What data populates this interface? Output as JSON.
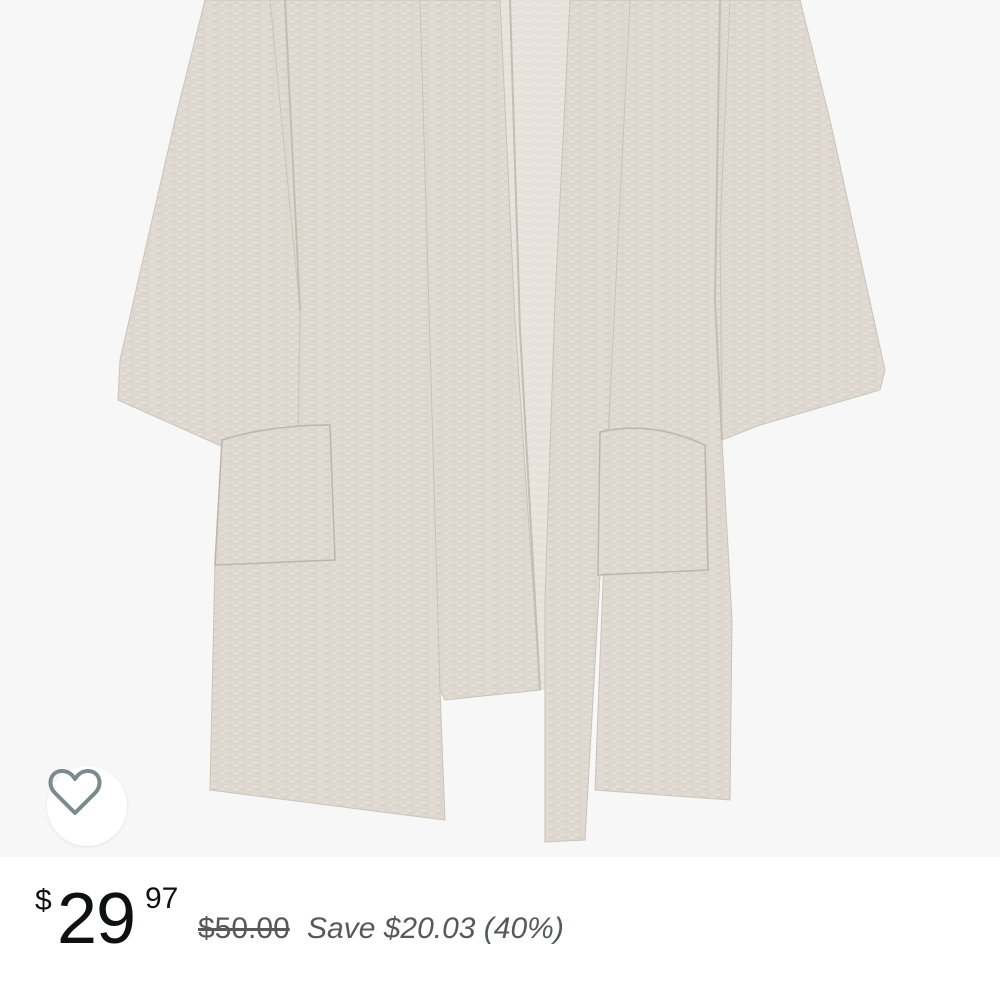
{
  "product": {
    "image_alt": "Oatmeal open-front long cardigan with pockets",
    "favorite_icon": "heart-outline-icon"
  },
  "price": {
    "currency": "$",
    "whole": "29",
    "fraction": "97",
    "list_price": "$50.00",
    "savings": "Save $20.03 (40%)"
  },
  "colors": {
    "background": "#ffffff",
    "image_background": "#f7f7f8",
    "text_primary": "#0f1111",
    "text_secondary": "#565959",
    "heart_stroke": "#7c8a8c",
    "fabric": "#ddd7cf"
  }
}
